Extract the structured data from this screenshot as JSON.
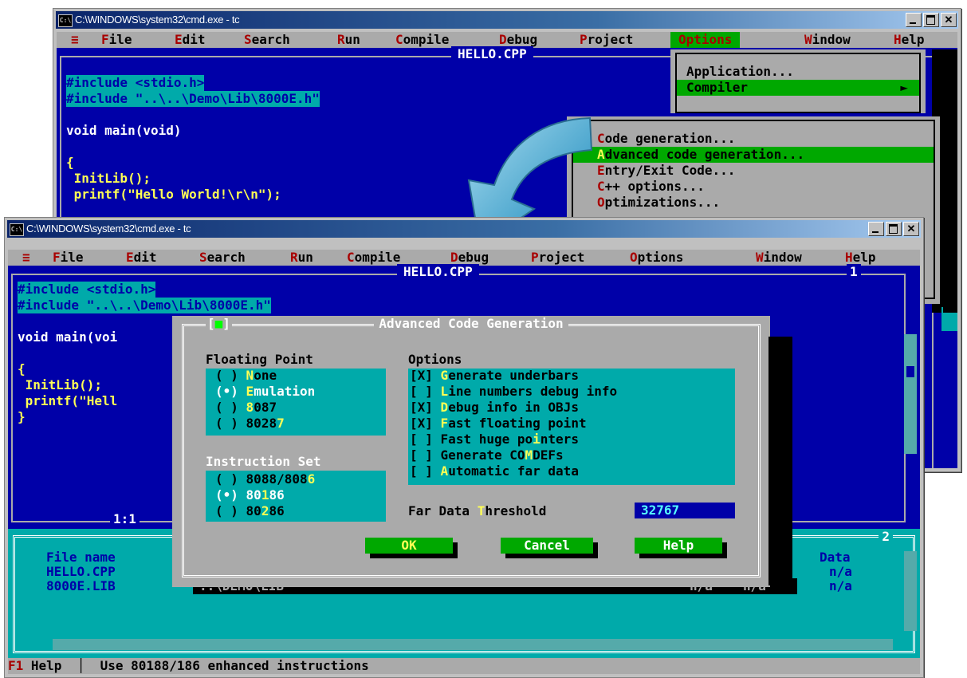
{
  "back_window": {
    "title": "C:\\WINDOWS\\system32\\cmd.exe - tc",
    "icon_text": "C:\\",
    "menu": [
      {
        "hk": "≡",
        "rest": ""
      },
      {
        "hk": "F",
        "rest": "ile"
      },
      {
        "hk": "E",
        "rest": "dit"
      },
      {
        "hk": "S",
        "rest": "earch"
      },
      {
        "hk": "R",
        "rest": "un"
      },
      {
        "hk": "C",
        "rest": "ompile"
      },
      {
        "hk": "D",
        "rest": "ebug"
      },
      {
        "hk": "P",
        "rest": "roject"
      },
      {
        "hk": "",
        "rest": "Options"
      },
      {
        "hk": "W",
        "rest": "indow"
      },
      {
        "hk": "H",
        "rest": "elp"
      }
    ],
    "file_title": "HELLO.CPP",
    "code_lines": [
      "#include <stdio.h>",
      "#include \"..\\..\\Demo\\Lib\\8000E.h\"",
      "",
      "void main(void)",
      "",
      "{",
      " InitLib();",
      " printf(\"Hello World!\\r\\n\");"
    ],
    "options_menu": {
      "item1": "Application...",
      "item2": "Compiler",
      "arrow": "►"
    },
    "compiler_submenu": [
      {
        "hk": "C",
        "rest": "ode generation..."
      },
      {
        "hk": "A",
        "rest": "dvanced code generation..."
      },
      {
        "hk": "E",
        "rest": "ntry/Exit Code..."
      },
      {
        "hk": "C",
        "rest": "++ options..."
      },
      {
        "hk": "O",
        "rest": "ptimizations..."
      }
    ]
  },
  "front_window": {
    "title": "C:\\WINDOWS\\system32\\cmd.exe - tc",
    "icon_text": "C:\\",
    "menu": [
      {
        "hk": "≡",
        "rest": ""
      },
      {
        "hk": "F",
        "rest": "ile"
      },
      {
        "hk": "E",
        "rest": "dit"
      },
      {
        "hk": "S",
        "rest": "earch"
      },
      {
        "hk": "R",
        "rest": "un"
      },
      {
        "hk": "C",
        "rest": "ompile"
      },
      {
        "hk": "D",
        "rest": "ebug"
      },
      {
        "hk": "P",
        "rest": "roject"
      },
      {
        "hk": "O",
        "rest": "ptions"
      },
      {
        "hk": "W",
        "rest": "indow"
      },
      {
        "hk": "H",
        "rest": "elp"
      }
    ],
    "file_title": "HELLO.CPP",
    "window_number": "1",
    "code_lines": [
      "#include <stdio.h>",
      "#include \"..\\..\\Demo\\Lib\\8000E.h\"",
      "",
      "void main(voi",
      "",
      "{",
      " InitLib();",
      " printf(\"Hell",
      "}"
    ],
    "cursor_pos": "1:1",
    "project_pane": {
      "title_num": "2",
      "headers": {
        "file": "File name",
        "data": "Data"
      },
      "rows": [
        {
          "file": "HELLO.CPP",
          "data": "n/a"
        },
        {
          "file": "8000E.LIB",
          "data": "n/a"
        }
      ],
      "dir": "..\\DEMO\\LIB",
      "col_a": "n/a",
      "col_b": "n/a",
      "hidden_col_header": "e",
      "hidden_col_row1": "a"
    },
    "status": {
      "key": "F1",
      "text": " Help  │  Use 80188/186 enhanced instructions"
    }
  },
  "dialog": {
    "title": "Advanced Code Generation",
    "close_glyph": "■",
    "floating_point": {
      "label": "Floating Point",
      "items": [
        {
          "mark": "( )",
          "pre": "",
          "hk": "N",
          "post": "one",
          "selected": false
        },
        {
          "mark": "(•)",
          "pre": "",
          "hk": "E",
          "post": "mulation",
          "selected": true
        },
        {
          "mark": "( )",
          "pre": "",
          "hk": "8",
          "post": "087",
          "selected": false
        },
        {
          "mark": "( )",
          "pre": "8028",
          "hk": "7",
          "post": "",
          "selected": false
        }
      ]
    },
    "instruction_set": {
      "label": "Instruction Set",
      "items": [
        {
          "mark": "( )",
          "pre": "8088/808",
          "hk": "6",
          "post": "",
          "selected": false
        },
        {
          "mark": "(•)",
          "pre": "80",
          "hk": "1",
          "post": "86",
          "selected": true
        },
        {
          "mark": "( )",
          "pre": "80",
          "hk": "2",
          "post": "86",
          "selected": false
        }
      ]
    },
    "options": {
      "label": "Options",
      "items": [
        {
          "mark": "[X]",
          "pre": "",
          "hk": "G",
          "post": "enerate underbars"
        },
        {
          "mark": "[ ]",
          "pre": "",
          "hk": "L",
          "post": "ine numbers debug info"
        },
        {
          "mark": "[X]",
          "pre": "",
          "hk": "D",
          "post": "ebug info in OBJs"
        },
        {
          "mark": "[X]",
          "pre": "",
          "hk": "F",
          "post": "ast floating point"
        },
        {
          "mark": "[ ]",
          "pre": "Fast huge po",
          "hk": "i",
          "post": "nters"
        },
        {
          "mark": "[ ]",
          "pre": "Generate CO",
          "hk": "M",
          "post": "DEFs"
        },
        {
          "mark": "[ ]",
          "pre": "",
          "hk": "A",
          "post": "utomatic far data"
        }
      ]
    },
    "threshold": {
      "pre": "Far Data ",
      "hk": "T",
      "post": "hreshold",
      "value": "32767"
    },
    "buttons": {
      "ok": "OK",
      "cancel": "Cancel",
      "help": "Help"
    }
  },
  "colors": {
    "dos_blue": "#0000a8",
    "dos_cyan": "#00aaaa",
    "dos_green": "#00a800",
    "dos_gray": "#aaaaaa",
    "arrow": "#3f9fc4"
  }
}
